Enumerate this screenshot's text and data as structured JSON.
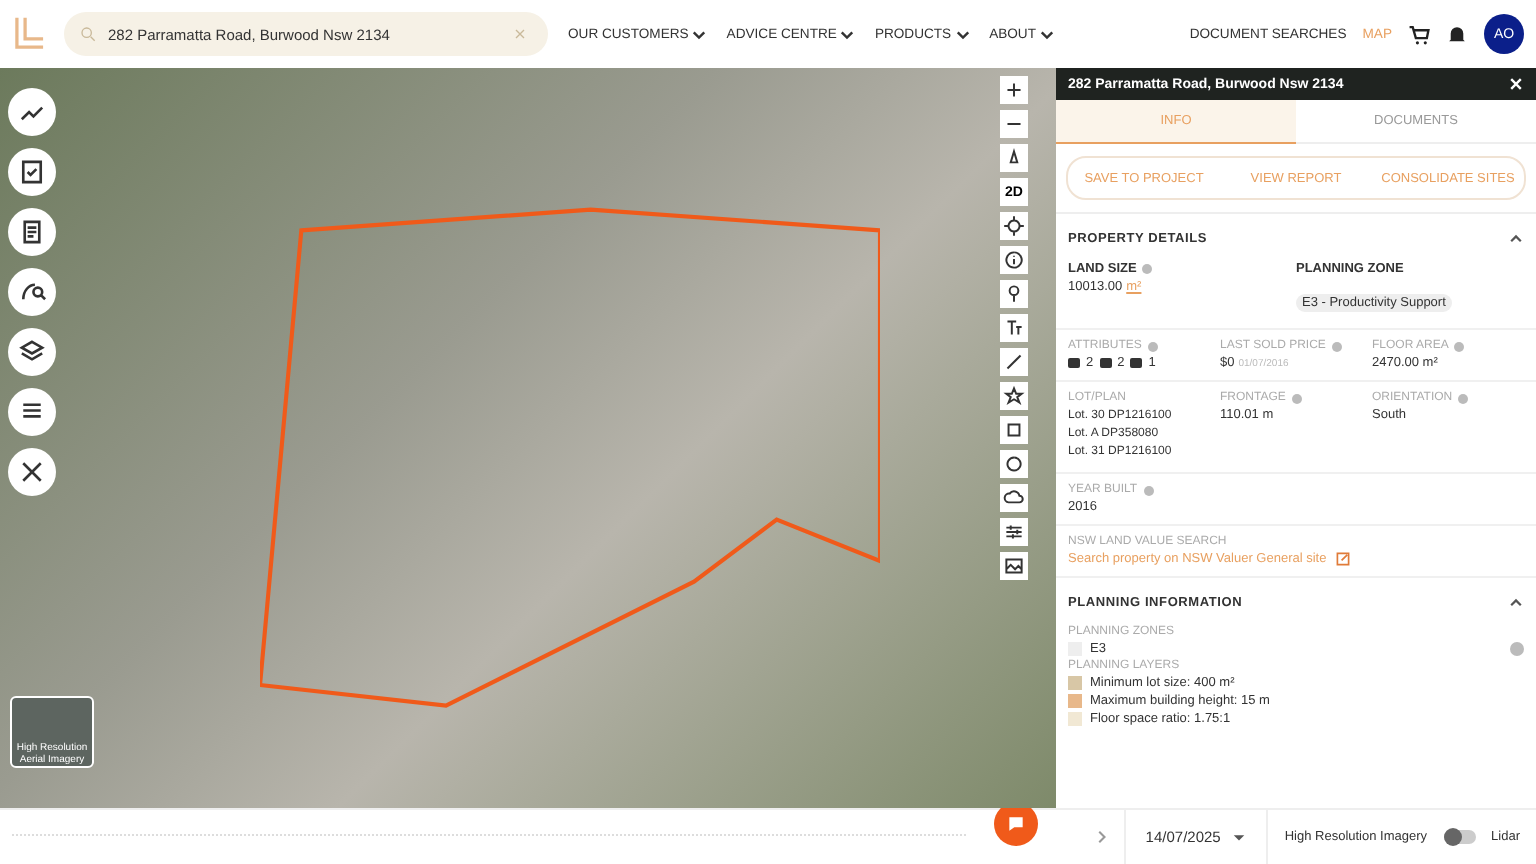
{
  "header": {
    "search_value": "282 Parramatta Road, Burwood Nsw 2134",
    "nav": [
      {
        "label": "OUR CUSTOMERS"
      },
      {
        "label": "ADVICE CENTRE"
      },
      {
        "label": "PRODUCTS"
      },
      {
        "label": "ABOUT"
      }
    ],
    "links": [
      {
        "label": "DOCUMENT SEARCHES",
        "selected": false
      },
      {
        "label": "MAP",
        "selected": true
      }
    ],
    "avatar": "AO"
  },
  "map": {
    "tools_left": [
      {
        "kind": "route"
      },
      {
        "kind": "checklist"
      },
      {
        "kind": "clipboard"
      },
      {
        "kind": "search"
      },
      {
        "kind": "layers"
      },
      {
        "kind": "list"
      },
      {
        "kind": "tools"
      }
    ],
    "tools_right": [
      {
        "kind": "plus"
      },
      {
        "kind": "minus"
      },
      {
        "kind": "compass"
      },
      {
        "kind": "label",
        "label": "2D"
      },
      {
        "kind": "locate"
      },
      {
        "kind": "info"
      },
      {
        "kind": "pin"
      },
      {
        "kind": "text"
      },
      {
        "kind": "measure"
      },
      {
        "kind": "star"
      },
      {
        "kind": "square"
      },
      {
        "kind": "circle"
      },
      {
        "kind": "cloud"
      },
      {
        "kind": "sliders"
      },
      {
        "kind": "image"
      }
    ],
    "imagery_badge": "High Resolution Aerial Imagery"
  },
  "panel": {
    "title": "282 Parramatta Road, Burwood Nsw 2134",
    "tabs": [
      {
        "label": "INFO",
        "selected": true
      },
      {
        "label": "DOCUMENTS",
        "selected": false
      }
    ],
    "actions": [
      "SAVE TO PROJECT",
      "VIEW REPORT",
      "CONSOLIDATE SITES"
    ],
    "property_details": {
      "heading": "PROPERTY DETAILS",
      "expanded": true,
      "land_size": {
        "label": "LAND SIZE",
        "value": "10013.00",
        "unit": "m²"
      },
      "planning_zone": {
        "label": "PLANNING ZONE",
        "value": "E3 - Productivity Support"
      },
      "attributes": {
        "label": "ATTRIBUTES",
        "bed": "2",
        "bath": "2",
        "car": "1"
      },
      "last_sold": {
        "label": "LAST SOLD PRICE",
        "value": "$0",
        "date": "01/07/2016"
      },
      "floor_area": {
        "label": "FLOOR AREA",
        "value": "2470.00 m²"
      },
      "lot_plan": {
        "label": "LOT/PLAN",
        "values": [
          "Lot. 30 DP1216100",
          "Lot. A DP358080",
          "Lot. 31 DP1216100"
        ]
      },
      "frontage": {
        "label": "FRONTAGE",
        "value": "110.01 m"
      },
      "orientation": {
        "label": "ORIENTATION",
        "value": "South"
      },
      "year_built": {
        "label": "YEAR BUILT",
        "value": "2016"
      },
      "land_value": {
        "label": "NSW LAND VALUE SEARCH",
        "link": "Search property on NSW Valuer General site"
      }
    },
    "planning": {
      "heading": "PLANNING INFORMATION",
      "expanded": true,
      "zones_label": "PLANNING ZONES",
      "zones": [
        {
          "label": "E3",
          "color": "#eeeeee"
        }
      ],
      "layers_label": "PLANNING LAYERS",
      "layers": [
        {
          "label": "Minimum lot size: 400 m²",
          "color": "#d8c7a6"
        },
        {
          "label": "Maximum building height: 15 m",
          "color": "#e8b88a"
        },
        {
          "label": "Floor space ratio: 1.75:1",
          "color": "#f1e8d4"
        }
      ]
    }
  },
  "bottom": {
    "date": "14/07/2025",
    "imagery": "High Resolution Imagery",
    "lidar": {
      "label": "Lidar",
      "on": false
    }
  }
}
